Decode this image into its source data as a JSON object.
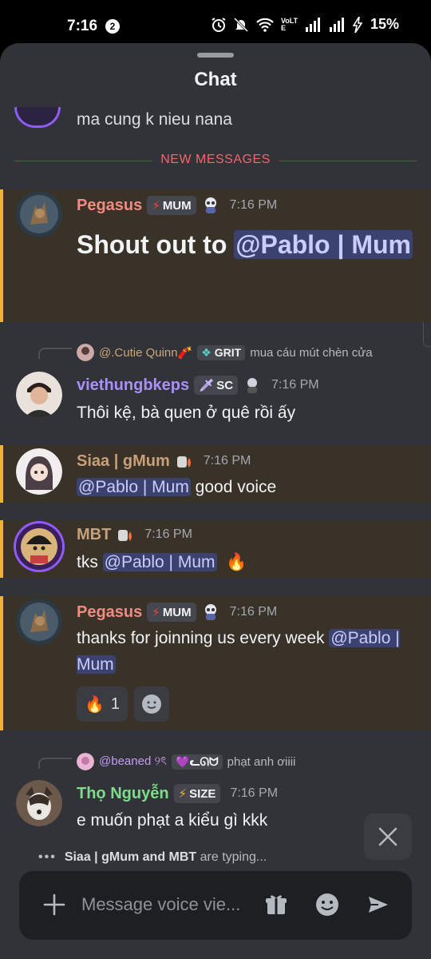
{
  "status_bar": {
    "time": "7:16",
    "notification_count": "2",
    "network_label": "VoLTE",
    "battery": "15%"
  },
  "header": {
    "title": "Chat"
  },
  "previous_message": {
    "text": "ma cung k nieu nana"
  },
  "divider": {
    "label": "NEW MESSAGES"
  },
  "messages": [
    {
      "author": "Pegasus",
      "author_color": "#f28b82",
      "tag": "MUM",
      "time": "7:16 PM",
      "body_text": "Shout out to ",
      "mention": "@Pablo | Mum",
      "highlighted": true
    },
    {
      "reply_to": {
        "author": "@.Cutie Quinn🧨",
        "tag": "GRIT",
        "text": "mua cáu mút chèn cửa"
      },
      "author": "viethungbkeps",
      "author_color": "#a98fff",
      "tag": "SC",
      "time": "7:16 PM",
      "body_text": "Thôi kệ, bà quen ở quê rồi ấy",
      "highlighted": false
    },
    {
      "author": "Siaa | gMum",
      "author_color": "#c8a07a",
      "time": "7:16 PM",
      "mention": "@Pablo | Mum",
      "body_text": " good voice",
      "highlighted": true
    },
    {
      "author": "MBT",
      "author_color": "#c8a07a",
      "time": "7:16 PM",
      "body_text": "tks ",
      "mention": "@Pablo | Mum",
      "emoji": "🔥",
      "highlighted": true
    },
    {
      "author": "Pegasus",
      "author_color": "#f28b82",
      "tag": "MUM",
      "time": "7:16 PM",
      "body_text": "thanks for joinning us every week ",
      "mention": "@Pablo | Mum",
      "reactions": [
        {
          "emoji": "🔥",
          "count": "1"
        }
      ],
      "highlighted": true
    },
    {
      "reply_to": {
        "author": "@beaned ୨ৎ",
        "tag": "ᓚᘏᗢ",
        "text": "phạt anh ơiiii"
      },
      "author": "Thọ Nguyễn",
      "author_color": "#7fdc8a",
      "tag": "SIZE",
      "time": "7:16 PM",
      "body_text": "e muốn phạt a kiểu gì kkk",
      "highlighted": false
    }
  ],
  "typing": {
    "names": "Siaa | gMum and MBT",
    "suffix": " are typing..."
  },
  "composer": {
    "placeholder": "Message voice vie..."
  },
  "colors": {
    "accent_highlight": "#f0b232",
    "mention_bg": "#3c4270",
    "new_messages": "#f2666b"
  }
}
